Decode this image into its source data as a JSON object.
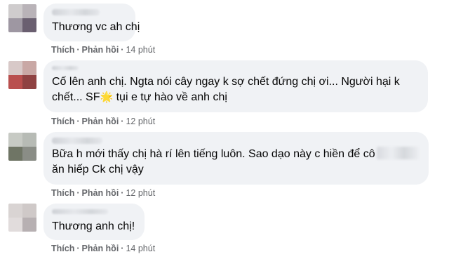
{
  "comments": [
    {
      "lines": [
        "Thương vc ah chị"
      ],
      "actions": {
        "like": "Thích",
        "reply": "Phản hồi",
        "time": "14 phút"
      }
    },
    {
      "lines": [
        "Cố lên anh chị. Ngta nói cây ngay k sợ chết đứng chị ơi... Người hại k"
      ],
      "line2_prefix": "chết... SF",
      "line2_emoji": "🌟",
      "line2_suffix": " tụi e tự hào về anh chị",
      "actions": {
        "like": "Thích",
        "reply": "Phản hồi",
        "time": "12 phút"
      }
    },
    {
      "line1_prefix": "Bữa h mới thấy chị hà rí lên tiếng luôn. Sao dạo này c hiền để cô",
      "line2": "ăn hiếp Ck chị vậy",
      "actions": {
        "like": "Thích",
        "reply": "Phản hồi",
        "time": "12 phút"
      }
    },
    {
      "lines": [
        "Thương anh chị!"
      ],
      "actions": {
        "like": "Thích",
        "reply": "Phản hồi",
        "time": "14 phút"
      }
    }
  ],
  "separator": "·",
  "colors": {
    "bubble": "#f0f2f5",
    "text": "#050505",
    "meta": "#65676b"
  }
}
